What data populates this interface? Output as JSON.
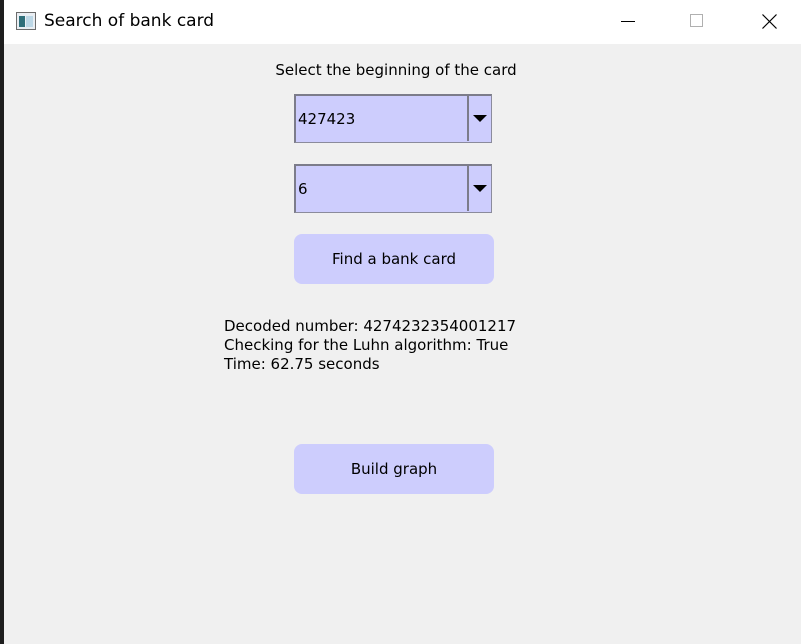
{
  "window": {
    "title": "Search of bank card",
    "controls": {
      "minimize": "minimize-icon",
      "maximize": "maximize-icon",
      "close": "close-icon"
    }
  },
  "form": {
    "label": "Select the beginning of the card",
    "bin_select": {
      "value": "427423"
    },
    "digit_select": {
      "value": "6"
    },
    "find_button": "Find a bank card",
    "graph_button": "Build graph"
  },
  "result": {
    "decoded": "Decoded number: 4274232354001217",
    "luhn": "Checking for the Luhn algorithm: True",
    "time": "Time: 62.75 seconds"
  },
  "colors": {
    "accent": "#cdcdfd",
    "background": "#f0f0f0",
    "titlebar": "#ffffff"
  }
}
